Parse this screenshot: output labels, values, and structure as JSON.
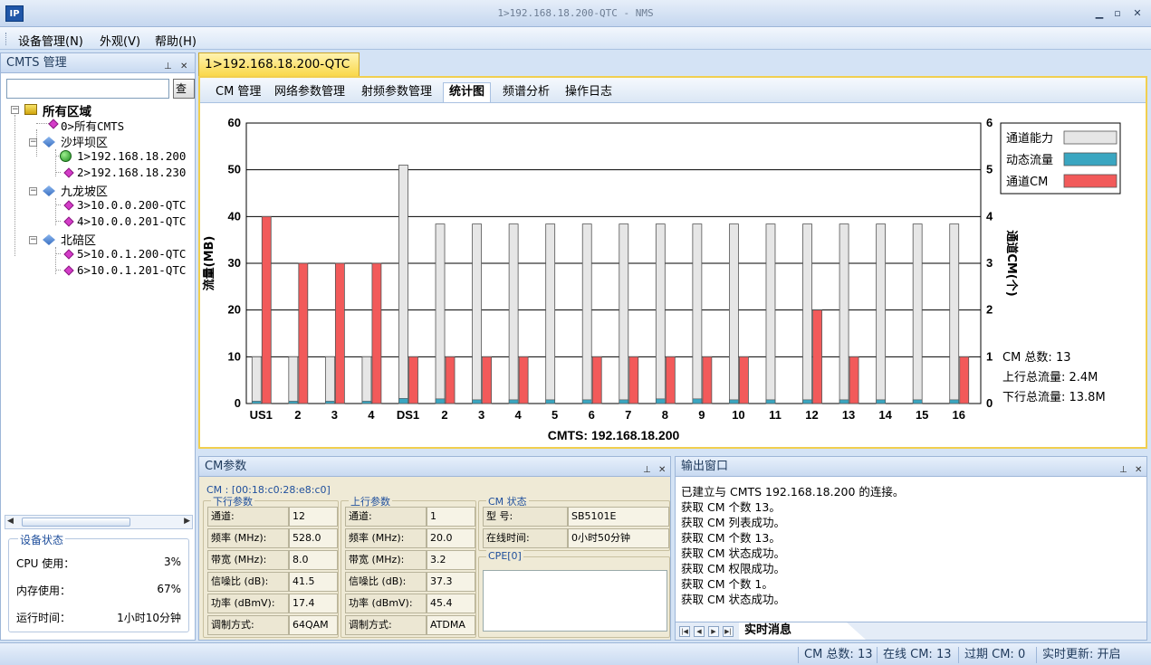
{
  "window": {
    "title": "1>192.168.18.200-QTC - NMS",
    "logo_text": "IP"
  },
  "menu": [
    "设备管理(N)",
    "外观(V)",
    "帮助(H)"
  ],
  "left_panel": {
    "title": "CMTS 管理",
    "search_button": "查找",
    "tree": {
      "root": "所有区域",
      "all": "0>所有CMTS",
      "zones": [
        {
          "name": "沙坪坝区",
          "items": [
            {
              "label": "1>192.168.18.200",
              "online": true
            },
            {
              "label": "2>192.168.18.230",
              "online": false
            }
          ]
        },
        {
          "name": "九龙坡区",
          "items": [
            {
              "label": "3>10.0.0.200-QTC",
              "online": false
            },
            {
              "label": "4>10.0.0.201-QTC",
              "online": false
            }
          ]
        },
        {
          "name": "北碚区",
          "items": [
            {
              "label": "5>10.0.1.200-QTC",
              "online": false
            },
            {
              "label": "6>10.0.1.201-QTC",
              "online": false
            }
          ]
        }
      ]
    },
    "device_status": {
      "title": "设备状态",
      "cpu_label": "CPU 使用：",
      "cpu_value": "3%",
      "mem_label": "内存使用：",
      "mem_value": "67%",
      "uptime_label": "运行时间：",
      "uptime_value": "1小时10分钟"
    }
  },
  "main": {
    "tab": "1>192.168.18.200-QTC",
    "subtabs": [
      "CM 管理",
      "网络参数管理",
      "射频参数管理",
      "统计图",
      "频谱分析",
      "操作日志"
    ],
    "active_subtab": 3
  },
  "chart_data": {
    "type": "bar",
    "title": "",
    "xlabel": "CMTS: 192.168.18.200",
    "ylabel": "流量(MB)",
    "y2label": "通道CM(个)",
    "ylim": [
      0,
      60
    ],
    "y2lim": [
      0,
      6
    ],
    "yticks": [
      0,
      10,
      20,
      30,
      40,
      50,
      60
    ],
    "y2ticks": [
      0,
      1,
      2,
      3,
      4,
      5,
      6
    ],
    "grid": true,
    "legend_position": "top-right",
    "categories": [
      "US1",
      "2",
      "3",
      "4",
      "DS1",
      "2",
      "3",
      "4",
      "5",
      "6",
      "7",
      "8",
      "9",
      "10",
      "11",
      "12",
      "13",
      "14",
      "15",
      "16"
    ],
    "series": [
      {
        "name": "通道能力",
        "color": "#e6e6e6",
        "axis": "left",
        "values": [
          10,
          10,
          10,
          10,
          51,
          38.4,
          38.4,
          38.4,
          38.4,
          38.4,
          38.4,
          38.4,
          38.4,
          38.4,
          38.4,
          38.4,
          38.4,
          38.4,
          38.4,
          38.4
        ]
      },
      {
        "name": "动态流量",
        "color": "#3aa6c1",
        "axis": "left",
        "values": [
          0.5,
          0.5,
          0.5,
          0.5,
          1.1,
          1.0,
          0.8,
          0.8,
          0.8,
          0.8,
          0.8,
          1.0,
          1.0,
          0.8,
          0.8,
          0.8,
          0.8,
          0.8,
          0.8,
          0.8
        ]
      },
      {
        "name": "通道CM",
        "color": "#f25a5a",
        "axis": "right",
        "values": [
          4,
          3,
          3,
          3,
          1,
          1,
          1,
          1,
          0,
          1,
          1,
          1,
          1,
          1,
          0,
          2,
          1,
          0,
          0,
          1
        ]
      }
    ],
    "annotations": [
      "CM 总数: 13",
      "上行总流量: 2.4M",
      "下行总流量: 13.8M"
    ]
  },
  "cm_panel": {
    "title": "CM参数",
    "cm_id": "CM : [00:18:c0:28:e8:c0]",
    "downstream": {
      "title": "下行参数",
      "rows": [
        [
          "通道:",
          "12"
        ],
        [
          "频率 (MHz):",
          "528.0"
        ],
        [
          "带宽 (MHz):",
          "8.0"
        ],
        [
          "信噪比 (dB):",
          "41.5"
        ],
        [
          "功率 (dBmV):",
          "17.4"
        ],
        [
          "调制方式:",
          "64QAM"
        ]
      ]
    },
    "upstream": {
      "title": "上行参数",
      "rows": [
        [
          "通道:",
          "1"
        ],
        [
          "频率 (MHz):",
          "20.0"
        ],
        [
          "带宽 (MHz):",
          "3.2"
        ],
        [
          "信噪比 (dB):",
          "37.3"
        ],
        [
          "功率 (dBmV):",
          "45.4"
        ],
        [
          "调制方式:",
          "ATDMA"
        ]
      ]
    },
    "cm_status": {
      "title": "CM 状态",
      "rows": [
        [
          "型  号:",
          "SB5101E"
        ],
        [
          "在线时间:",
          "0小时50分钟"
        ]
      ]
    },
    "cpe_title": "CPE[0]"
  },
  "output_panel": {
    "title": "输出窗口",
    "messages": [
      "已建立与 CMTS 192.168.18.200 的连接。",
      "获取 CM 个数  13。",
      "获取 CM 列表成功。",
      "获取 CM 个数  13。",
      "获取 CM 状态成功。",
      "获取 CM 权限成功。",
      "获取 CM 个数  1。",
      "获取 CM 状态成功。"
    ],
    "tab": "实时消息"
  },
  "statusbar": [
    "CM 总数: 13",
    "在线 CM: 13",
    "过期 CM: 0",
    "实时更新: 开启"
  ]
}
